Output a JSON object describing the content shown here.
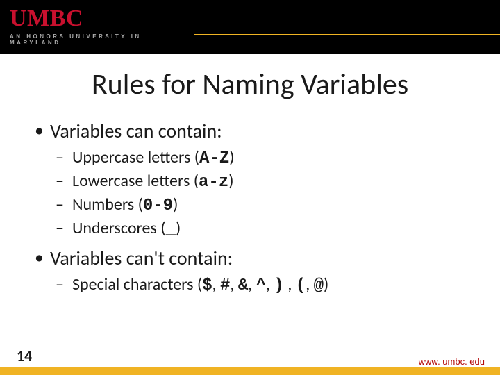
{
  "header": {
    "logo": "UMBC",
    "tagline": "AN HONORS UNIVERSITY IN MARYLAND"
  },
  "title": "Rules for Naming Variables",
  "bullets": {
    "b1a": "Variables can contain:",
    "b2a": "Uppercase letters (",
    "b2a_code": "A-Z",
    "b2a_end": ")",
    "b2b": "Lowercase letters (",
    "b2b_code": "a-z",
    "b2b_end": ")",
    "b2c": "Numbers (",
    "b2c_code": "0-9",
    "b2c_end": ")",
    "b2d": "Underscores (",
    "b2d_code": "_",
    "b2d_end": ")",
    "b1b": "Variables can't contain:",
    "b2e": "Special characters (",
    "b2e_code": "$",
    "b2e_s1": ", ",
    "b2e_code2": "#",
    "b2e_s2": ", ",
    "b2e_code3": "&",
    "b2e_s3": ", ",
    "b2e_code4": "^",
    "b2e_s4": ", ",
    "b2e_code5": ")",
    "b2e_s5": " , ",
    "b2e_code6": "(",
    "b2e_s6": ", ",
    "b2e_code7": "@",
    "b2e_end": ")"
  },
  "footer": {
    "page": "14",
    "url": "www. umbc. edu"
  }
}
